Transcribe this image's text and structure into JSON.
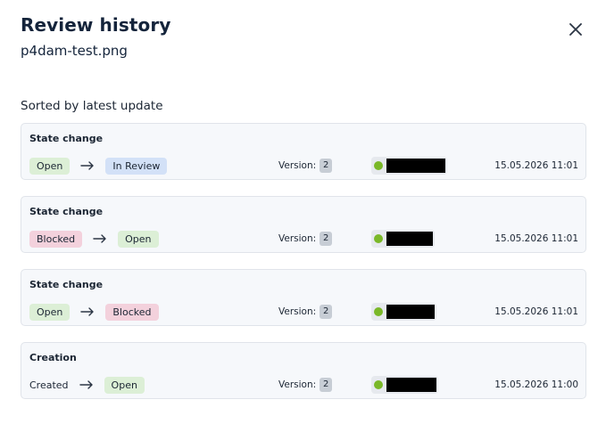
{
  "header": {
    "title": "Review history",
    "filename": "p4dam-test.png",
    "close_icon": "close-icon"
  },
  "sort_label": "Sorted by latest update",
  "colors": {
    "open": "#dcefd6",
    "in_review": "#d3e1f7",
    "blocked": "#f3d1dc"
  },
  "version_label": "Version:",
  "entries": [
    {
      "title": "State change",
      "from": {
        "label": "Open",
        "style": "open"
      },
      "to": {
        "label": "In Review",
        "style": "in_review"
      },
      "version": "2",
      "date": "15.05.2026 11:01"
    },
    {
      "title": "State change",
      "from": {
        "label": "Blocked",
        "style": "blocked"
      },
      "to": {
        "label": "Open",
        "style": "open"
      },
      "version": "2",
      "date": "15.05.2026 11:01"
    },
    {
      "title": "State change",
      "from": {
        "label": "Open",
        "style": "open"
      },
      "to": {
        "label": "Blocked",
        "style": "blocked"
      },
      "version": "2",
      "date": "15.05.2026 11:01"
    },
    {
      "title": "Creation",
      "from": {
        "label": "Created",
        "style": "plain"
      },
      "to": {
        "label": "Open",
        "style": "open"
      },
      "version": "2",
      "date": "15.05.2026 11:00"
    }
  ]
}
